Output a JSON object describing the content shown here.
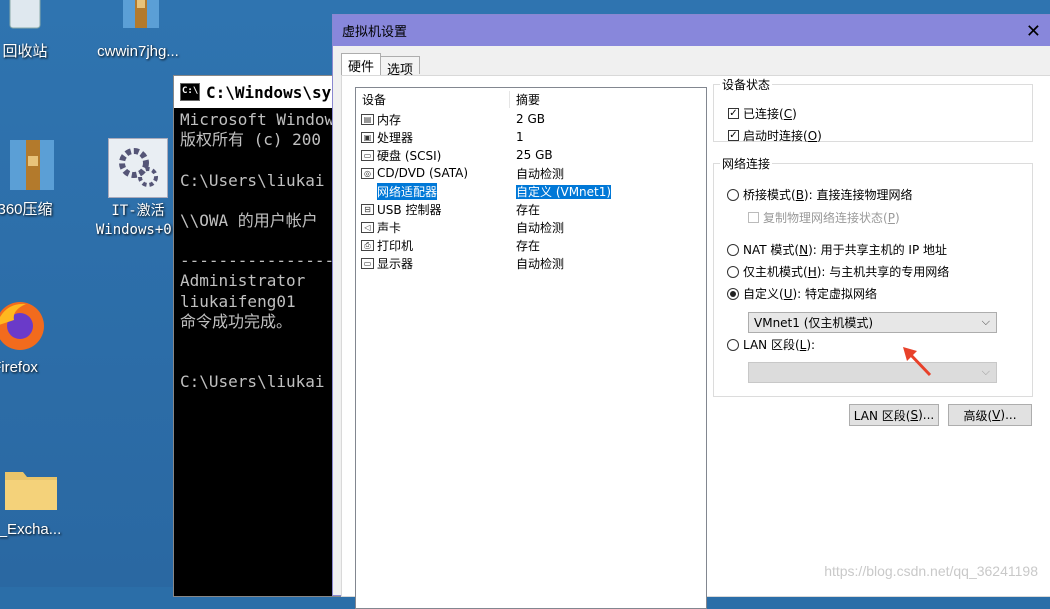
{
  "desktop": {
    "icons": [
      {
        "label": "回收站",
        "icon": "recycle-bin-icon"
      },
      {
        "label": "cwwin7jhg...",
        "icon": "archive-icon"
      },
      {
        "label": "360压缩",
        "icon": "archive-icon"
      },
      {
        "label": "IT-激活\nWindows+0.",
        "icon": "gear-icon"
      },
      {
        "label": "Firefox",
        "icon": "firefox-icon"
      },
      {
        "label": "_Excha...",
        "icon": "folder-icon"
      }
    ]
  },
  "console": {
    "title": "C:\\Windows\\sy",
    "lines": [
      "Microsoft Window",
      "版权所有 (c) 200",
      "",
      "C:\\Users\\liukai",
      "",
      "\\\\OWA 的用户帐户",
      "",
      "----------------",
      "Administrator",
      "liukaifeng01",
      "命令成功完成。",
      "",
      "",
      "C:\\Users\\liukai"
    ]
  },
  "dialog": {
    "title": "虚拟机设置",
    "tabs": [
      "硬件",
      "选项"
    ],
    "list": {
      "headers": [
        "设备",
        "摘要"
      ],
      "rows": [
        {
          "device": "内存",
          "summary": "2 GB",
          "icon": "memory-icon"
        },
        {
          "device": "处理器",
          "summary": "1",
          "icon": "cpu-icon"
        },
        {
          "device": "硬盘 (SCSI)",
          "summary": "25 GB",
          "icon": "hard-disk-icon"
        },
        {
          "device": "CD/DVD (SATA)",
          "summary": "自动检测",
          "icon": "cd-dvd-icon"
        },
        {
          "device": "网络适配器",
          "summary": "自定义 (VMnet1)",
          "icon": "network-adapter-icon"
        },
        {
          "device": "USB 控制器",
          "summary": "存在",
          "icon": "usb-icon"
        },
        {
          "device": "声卡",
          "summary": "自动检测",
          "icon": "speaker-icon"
        },
        {
          "device": "打印机",
          "summary": "存在",
          "icon": "printer-icon"
        },
        {
          "device": "显示器",
          "summary": "自动检测",
          "icon": "monitor-icon"
        }
      ]
    },
    "device_status": {
      "legend": "设备状态",
      "connected": {
        "text": "已连接(",
        "key": "C",
        "tail": ")"
      },
      "connect_on_start": {
        "text": "启动时连接(",
        "key": "O",
        "tail": ")"
      }
    },
    "network": {
      "legend": "网络连接",
      "bridged": {
        "text": "桥接模式(",
        "key": "B",
        "tail": "): 直接连接物理网络"
      },
      "replicate": {
        "text": "复制物理网络连接状态(",
        "key": "P",
        "tail": ")"
      },
      "nat": {
        "text": "NAT 模式(",
        "key": "N",
        "tail": "): 用于共享主机的 IP 地址"
      },
      "host_only": {
        "text": "仅主机模式(",
        "key": "H",
        "tail": "): 与主机共享的专用网络"
      },
      "custom": {
        "text": "自定义(",
        "key": "U",
        "tail": "): 特定虚拟网络"
      },
      "custom_value": "VMnet1 (仅主机模式)",
      "lan": {
        "text": "LAN 区段(",
        "key": "L",
        "tail": "):"
      }
    },
    "buttons": {
      "lan_segments": {
        "text": "LAN 区段(",
        "key": "S",
        "tail": ")..."
      },
      "advanced": {
        "text": "高级(",
        "key": "V",
        "tail": ")..."
      }
    }
  },
  "watermark": "https://blog.csdn.net/qq_36241198",
  "colors": {
    "selection": "#0078d7",
    "dialog_title": "#8887db",
    "arrow": "#e8412a"
  }
}
